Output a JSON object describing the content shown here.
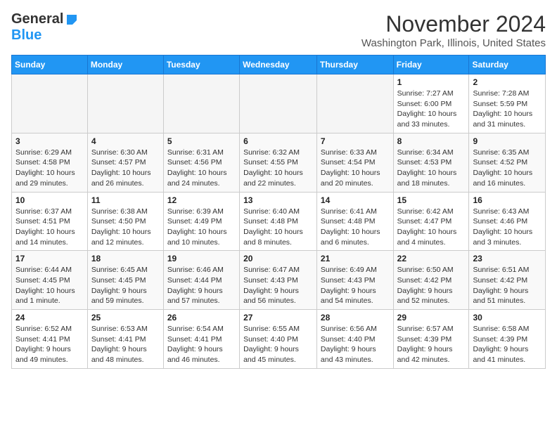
{
  "header": {
    "logo_general": "General",
    "logo_blue": "Blue",
    "month": "November 2024",
    "location": "Washington Park, Illinois, United States"
  },
  "days_of_week": [
    "Sunday",
    "Monday",
    "Tuesday",
    "Wednesday",
    "Thursday",
    "Friday",
    "Saturday"
  ],
  "weeks": [
    {
      "days": [
        {
          "number": "",
          "info": ""
        },
        {
          "number": "",
          "info": ""
        },
        {
          "number": "",
          "info": ""
        },
        {
          "number": "",
          "info": ""
        },
        {
          "number": "",
          "info": ""
        },
        {
          "number": "1",
          "info": "Sunrise: 7:27 AM\nSunset: 6:00 PM\nDaylight: 10 hours\nand 33 minutes."
        },
        {
          "number": "2",
          "info": "Sunrise: 7:28 AM\nSunset: 5:59 PM\nDaylight: 10 hours\nand 31 minutes."
        }
      ]
    },
    {
      "days": [
        {
          "number": "3",
          "info": "Sunrise: 6:29 AM\nSunset: 4:58 PM\nDaylight: 10 hours\nand 29 minutes."
        },
        {
          "number": "4",
          "info": "Sunrise: 6:30 AM\nSunset: 4:57 PM\nDaylight: 10 hours\nand 26 minutes."
        },
        {
          "number": "5",
          "info": "Sunrise: 6:31 AM\nSunset: 4:56 PM\nDaylight: 10 hours\nand 24 minutes."
        },
        {
          "number": "6",
          "info": "Sunrise: 6:32 AM\nSunset: 4:55 PM\nDaylight: 10 hours\nand 22 minutes."
        },
        {
          "number": "7",
          "info": "Sunrise: 6:33 AM\nSunset: 4:54 PM\nDaylight: 10 hours\nand 20 minutes."
        },
        {
          "number": "8",
          "info": "Sunrise: 6:34 AM\nSunset: 4:53 PM\nDaylight: 10 hours\nand 18 minutes."
        },
        {
          "number": "9",
          "info": "Sunrise: 6:35 AM\nSunset: 4:52 PM\nDaylight: 10 hours\nand 16 minutes."
        }
      ]
    },
    {
      "days": [
        {
          "number": "10",
          "info": "Sunrise: 6:37 AM\nSunset: 4:51 PM\nDaylight: 10 hours\nand 14 minutes."
        },
        {
          "number": "11",
          "info": "Sunrise: 6:38 AM\nSunset: 4:50 PM\nDaylight: 10 hours\nand 12 minutes."
        },
        {
          "number": "12",
          "info": "Sunrise: 6:39 AM\nSunset: 4:49 PM\nDaylight: 10 hours\nand 10 minutes."
        },
        {
          "number": "13",
          "info": "Sunrise: 6:40 AM\nSunset: 4:48 PM\nDaylight: 10 hours\nand 8 minutes."
        },
        {
          "number": "14",
          "info": "Sunrise: 6:41 AM\nSunset: 4:48 PM\nDaylight: 10 hours\nand 6 minutes."
        },
        {
          "number": "15",
          "info": "Sunrise: 6:42 AM\nSunset: 4:47 PM\nDaylight: 10 hours\nand 4 minutes."
        },
        {
          "number": "16",
          "info": "Sunrise: 6:43 AM\nSunset: 4:46 PM\nDaylight: 10 hours\nand 3 minutes."
        }
      ]
    },
    {
      "days": [
        {
          "number": "17",
          "info": "Sunrise: 6:44 AM\nSunset: 4:45 PM\nDaylight: 10 hours\nand 1 minute."
        },
        {
          "number": "18",
          "info": "Sunrise: 6:45 AM\nSunset: 4:45 PM\nDaylight: 9 hours\nand 59 minutes."
        },
        {
          "number": "19",
          "info": "Sunrise: 6:46 AM\nSunset: 4:44 PM\nDaylight: 9 hours\nand 57 minutes."
        },
        {
          "number": "20",
          "info": "Sunrise: 6:47 AM\nSunset: 4:43 PM\nDaylight: 9 hours\nand 56 minutes."
        },
        {
          "number": "21",
          "info": "Sunrise: 6:49 AM\nSunset: 4:43 PM\nDaylight: 9 hours\nand 54 minutes."
        },
        {
          "number": "22",
          "info": "Sunrise: 6:50 AM\nSunset: 4:42 PM\nDaylight: 9 hours\nand 52 minutes."
        },
        {
          "number": "23",
          "info": "Sunrise: 6:51 AM\nSunset: 4:42 PM\nDaylight: 9 hours\nand 51 minutes."
        }
      ]
    },
    {
      "days": [
        {
          "number": "24",
          "info": "Sunrise: 6:52 AM\nSunset: 4:41 PM\nDaylight: 9 hours\nand 49 minutes."
        },
        {
          "number": "25",
          "info": "Sunrise: 6:53 AM\nSunset: 4:41 PM\nDaylight: 9 hours\nand 48 minutes."
        },
        {
          "number": "26",
          "info": "Sunrise: 6:54 AM\nSunset: 4:41 PM\nDaylight: 9 hours\nand 46 minutes."
        },
        {
          "number": "27",
          "info": "Sunrise: 6:55 AM\nSunset: 4:40 PM\nDaylight: 9 hours\nand 45 minutes."
        },
        {
          "number": "28",
          "info": "Sunrise: 6:56 AM\nSunset: 4:40 PM\nDaylight: 9 hours\nand 43 minutes."
        },
        {
          "number": "29",
          "info": "Sunrise: 6:57 AM\nSunset: 4:39 PM\nDaylight: 9 hours\nand 42 minutes."
        },
        {
          "number": "30",
          "info": "Sunrise: 6:58 AM\nSunset: 4:39 PM\nDaylight: 9 hours\nand 41 minutes."
        }
      ]
    }
  ]
}
